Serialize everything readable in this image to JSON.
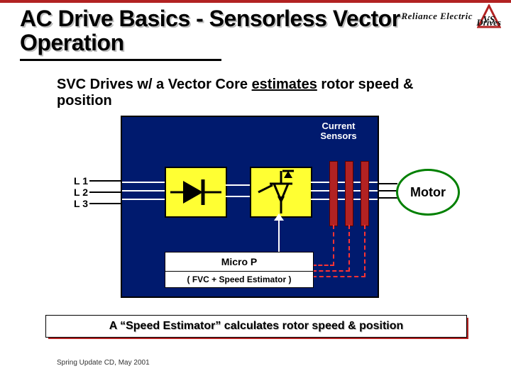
{
  "brand": {
    "line1": "Reliance Electric",
    "line2": "Drives"
  },
  "title": "AC Drive Basics - Sensorless Vector Operation",
  "subtitle": {
    "pre": "SVC Drives w/ a Vector Core ",
    "underlined": "estimates",
    "post": " rotor speed & position"
  },
  "diagram": {
    "current_sensors_label": "Current Sensors",
    "inputs": [
      "L 1",
      "L 2",
      "L 3"
    ],
    "micro_p": {
      "top": "Micro P",
      "bottom": "( FVC + Speed Estimator )"
    },
    "motor_label": "Motor",
    "blocks": {
      "rectifier": "rectifier-diode",
      "inverter": "inverter-igbt"
    }
  },
  "callout": "A “Speed Estimator” calculates  rotor speed & position",
  "footer": "Spring Update CD, May 2001",
  "colors": {
    "panel": "#001a6e",
    "accent_red": "#b22222",
    "block_yellow": "#ffff33",
    "motor_green": "#008000",
    "feedback_red": "#ff3333"
  }
}
